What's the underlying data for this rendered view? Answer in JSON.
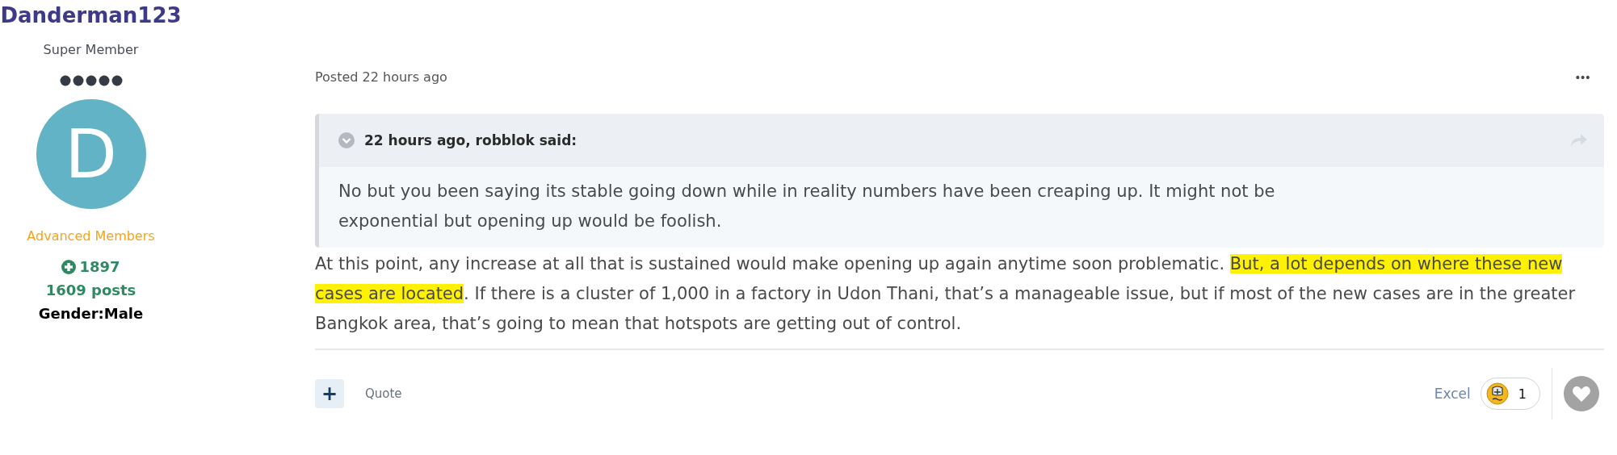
{
  "author": {
    "username": "Danderman123",
    "rank": "Super Member",
    "stars": 5,
    "avatar_letter": "D",
    "group": "Advanced Members",
    "reputation": "1897",
    "posts": "1609 posts",
    "gender": "Gender:Male"
  },
  "post": {
    "posted": "Posted 22 hours ago",
    "menu": "•••",
    "quote": {
      "citation": "22 hours ago, robblok said:",
      "expanded": false,
      "text": "No but you been saying its stable going down while in reality numbers have been creaping up. It might not be exponential but opening up would be foolish."
    },
    "body": [
      {
        "text": "At this point, any increase at all that is sustained would make opening up again anytime soon problematic.  ",
        "highlighted": false
      },
      {
        "text": "But, a lot depends on where these new cases are located",
        "highlighted": true
      },
      {
        "text": ". If there is a cluster of 1,000 in a factory in Udon Thani, that’s a manageable issue, but if most of the new cases are in the greater Bangkok area, that’s going to mean that hotspots are getting out of control.",
        "highlighted": false
      }
    ],
    "footer": {
      "multiquote": "+",
      "quote_link": "Quote",
      "reaction_label": "Excel",
      "reaction_count": "1",
      "liked": false
    }
  }
}
